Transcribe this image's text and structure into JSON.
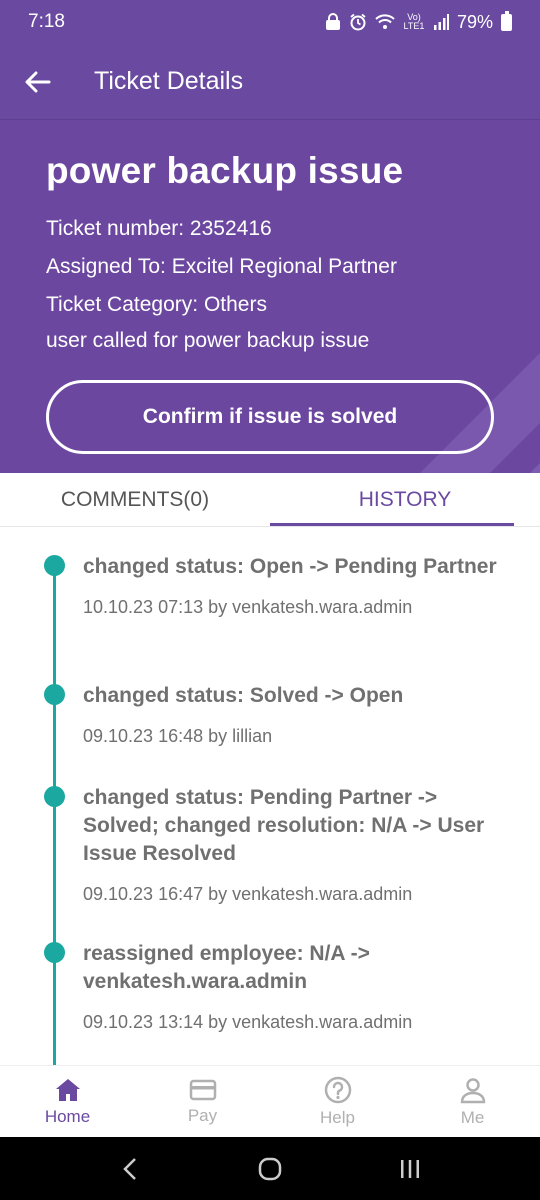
{
  "status_bar": {
    "time": "7:18",
    "battery": "79%",
    "network": "Vo) LTE1"
  },
  "app_bar": {
    "title": "Ticket Details"
  },
  "ticket": {
    "title": "power backup issue",
    "number_line": "Ticket number: 2352416",
    "assigned_line": "Assigned To: Excitel Regional Partner",
    "category_line": "Ticket Category: Others",
    "description": "user called for power backup issue",
    "confirm_label": "Confirm if issue is solved"
  },
  "tabs": [
    {
      "label": "COMMENTS(0)",
      "active": false
    },
    {
      "label": "HISTORY",
      "active": true
    }
  ],
  "history": [
    {
      "title": "changed status: Open -> Pending Partner",
      "meta": "10.10.23 07:13 by venkatesh.wara.admin"
    },
    {
      "title": "changed status: Solved -> Open",
      "meta": "09.10.23 16:48 by lillian"
    },
    {
      "title": "changed status: Pending Partner -> Solved; changed resolution: N/A -> User Issue Resolved",
      "meta": "09.10.23 16:47 by venkatesh.wara.admin"
    },
    {
      "title": "reassigned employee: N/A -> venkatesh.wara.admin",
      "meta": "09.10.23 13:14 by venkatesh.wara.admin"
    }
  ],
  "bottom_nav": [
    {
      "label": "Home",
      "icon": "home-icon",
      "active": true
    },
    {
      "label": "Pay",
      "icon": "card-icon",
      "active": false
    },
    {
      "label": "Help",
      "icon": "help-icon",
      "active": false
    },
    {
      "label": "Me",
      "icon": "person-icon",
      "active": false
    }
  ],
  "colors": {
    "primary": "#6a4aa0",
    "accent": "#1aa8a0",
    "text_gray": "#707070"
  }
}
